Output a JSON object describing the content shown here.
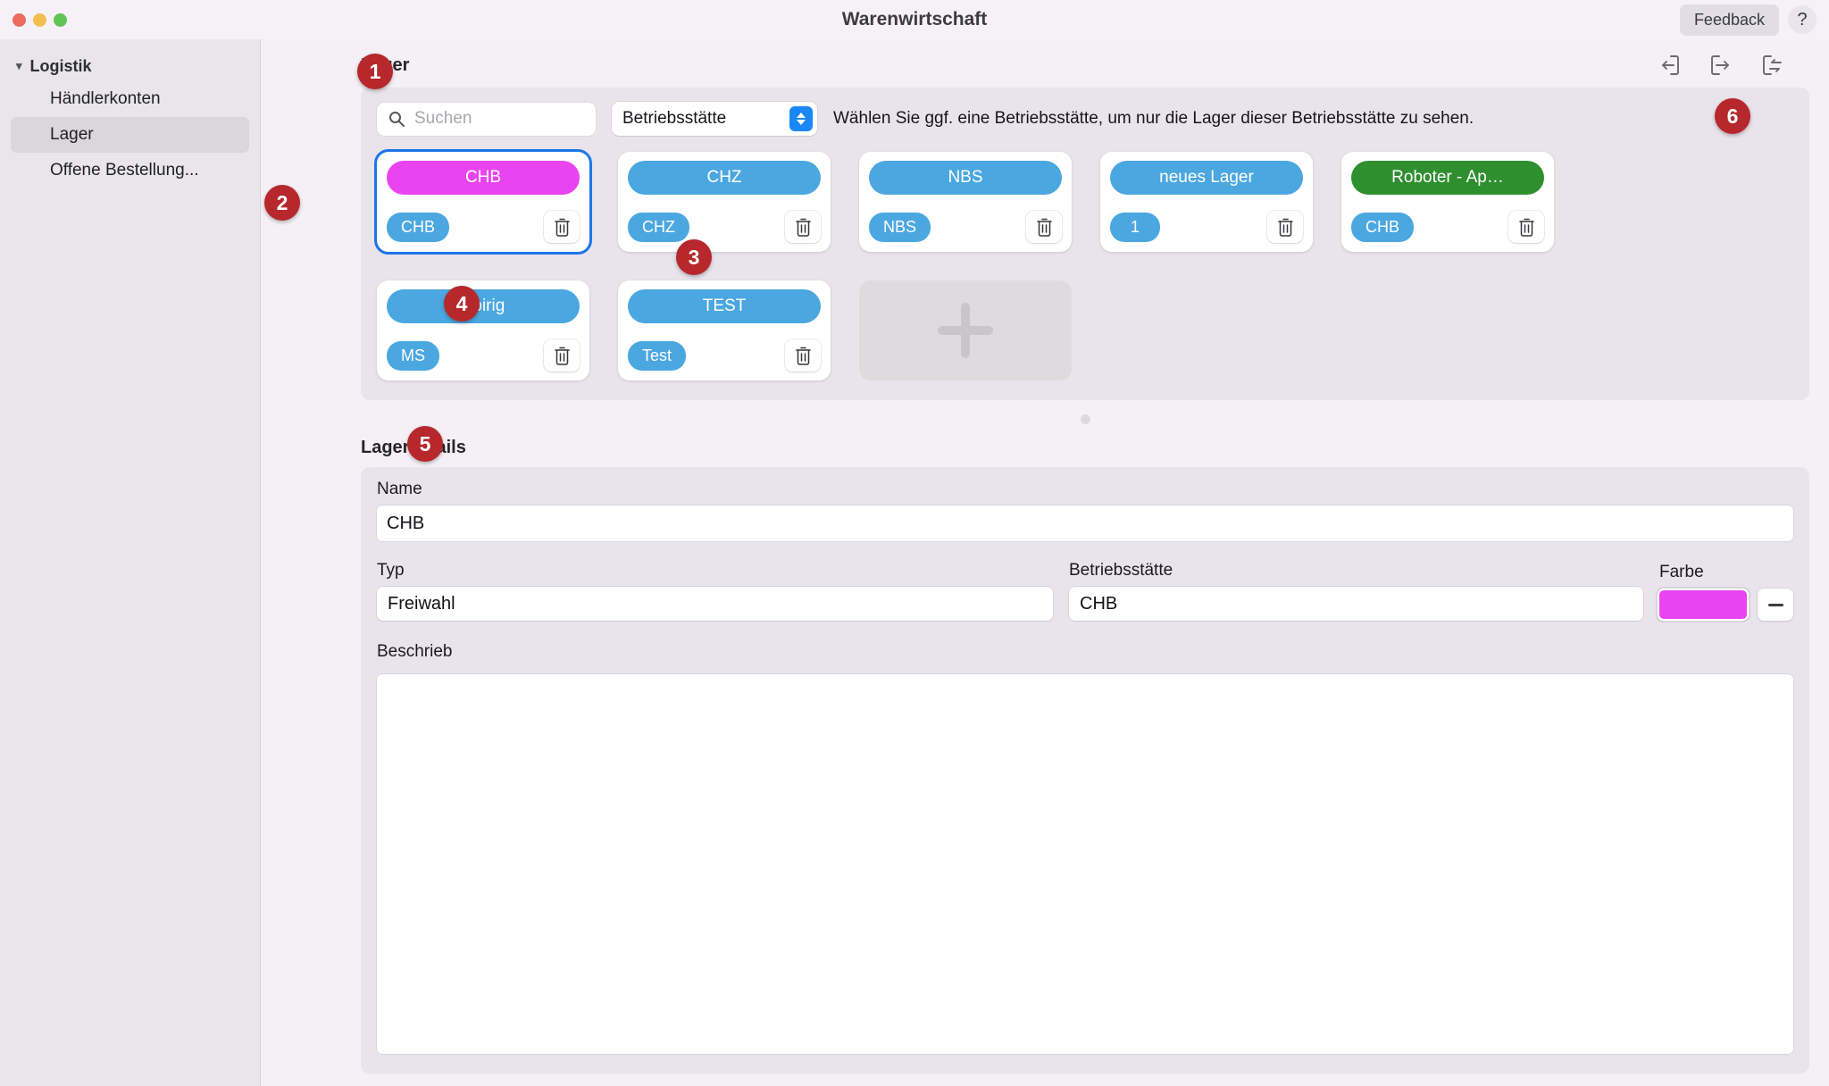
{
  "window": {
    "title": "Warenwirtschaft",
    "feedback_label": "Feedback",
    "help_label": "?"
  },
  "sidebar": {
    "group_label": "Logistik",
    "items": [
      {
        "label": "Händlerkonten",
        "selected": false
      },
      {
        "label": "Lager",
        "selected": true
      },
      {
        "label": "Offene Bestellung...",
        "selected": false
      }
    ]
  },
  "lager_section": {
    "title": "Lager",
    "toolbar": {
      "import_icon": "import-icon",
      "export_icon": "export-icon",
      "sync_icon": "sync-icon"
    },
    "search": {
      "placeholder": "Suchen",
      "value": "",
      "icon": "search-icon"
    },
    "filter_select": {
      "value": "Betriebsstätte"
    },
    "hint": "Wählen Sie ggf. eine Betriebsstätte, um nur die Lager dieser Betriebsstätte zu sehen.",
    "add_card_label": "+",
    "cards": [
      {
        "title": "CHB",
        "color": "#ea44f0",
        "tag": "CHB",
        "selected": true,
        "delete_icon": "trash-icon"
      },
      {
        "title": "CHZ",
        "color": "#4ba7e0",
        "tag": "CHZ",
        "selected": false,
        "delete_icon": "trash-icon"
      },
      {
        "title": "NBS",
        "color": "#4ba7e0",
        "tag": "NBS",
        "selected": false,
        "delete_icon": "trash-icon"
      },
      {
        "title": "neues Lager",
        "color": "#4ba7e0",
        "tag": "1",
        "selected": false,
        "delete_icon": "trash-icon"
      },
      {
        "title": "Roboter - Ap…",
        "color": "#2f8f2f",
        "tag": "CHB",
        "selected": false,
        "delete_icon": "trash-icon"
      },
      {
        "title": "Spirig",
        "color": "#4ba7e0",
        "tag": "MS",
        "selected": false,
        "delete_icon": "trash-icon"
      },
      {
        "title": "TEST",
        "color": "#4ba7e0",
        "tag": "Test",
        "selected": false,
        "delete_icon": "trash-icon"
      }
    ]
  },
  "details_section": {
    "title": "Lagerdetails",
    "name": {
      "label": "Name",
      "value": "CHB"
    },
    "typ": {
      "label": "Typ",
      "value": "Freiwahl"
    },
    "betriebsstaette": {
      "label": "Betriebsstätte",
      "value": "CHB"
    },
    "farbe": {
      "label": "Farbe",
      "value": "#ea44f0",
      "clear_label": "−"
    },
    "beschrieb": {
      "label": "Beschrieb",
      "value": ""
    }
  },
  "annotations": [
    {
      "num": "1"
    },
    {
      "num": "2"
    },
    {
      "num": "3"
    },
    {
      "num": "4"
    },
    {
      "num": "5"
    },
    {
      "num": "6"
    }
  ],
  "colors": {
    "accent_blue": "#1b87f7",
    "selection_blue": "#1d76e8",
    "badge_red": "#b6282c",
    "tag_blue": "#4ba7e0"
  }
}
